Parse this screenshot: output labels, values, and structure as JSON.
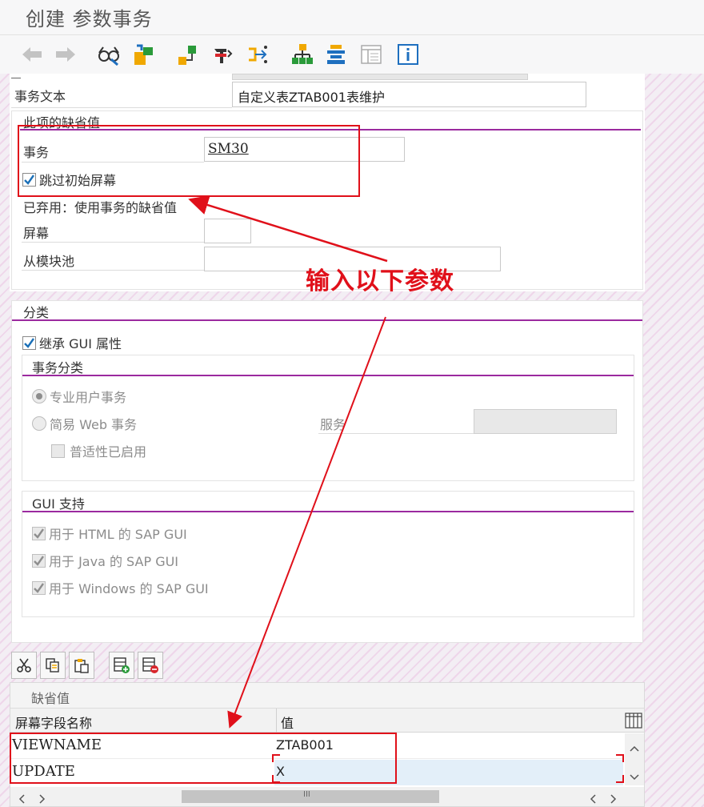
{
  "window": {
    "title": "创建 参数事务"
  },
  "toolbar": {
    "icons": [
      "back-arrow-icon",
      "forward-arrow-icon",
      "glasses-icon",
      "transport-icon",
      "hierarchy-icon",
      "where-used-icon",
      "navigate-icon",
      "tree-icon",
      "stack-icon",
      "layout-icon",
      "info-icon"
    ]
  },
  "transaction": {
    "text_label": "事务文本",
    "text_value": "自定义表ZTAB001表维护"
  },
  "defaults": {
    "title": "此项的缺省值",
    "transaction_label": "事务",
    "transaction_value": "SM30",
    "skip_initial_label": "跳过初始屏幕",
    "deprecated_text": "已弃用：使用事务的缺省值",
    "screen_label": "屏幕",
    "module_pool_label": "从模块池"
  },
  "annotation": {
    "text": "输入以下参数",
    "color": "#e0101a"
  },
  "classification": {
    "title": "分类",
    "inherit_gui_label": "继承 GUI 属性",
    "tx_class_title": "事务分类",
    "pro_user_label": "专业用户事务",
    "easy_web_label": "简易 Web 事务",
    "service_label": "服务",
    "pervasive_label": "普适性已启用",
    "gui_support_title": "GUI 支持",
    "html_gui_label": "用于 HTML 的 SAP GUI",
    "java_gui_label": "用于 Java 的 SAP GUI",
    "windows_gui_label": "用于 Windows 的 SAP GUI"
  },
  "grid": {
    "title": "缺省值",
    "col_name": "屏幕字段名称",
    "col_value": "值",
    "rows": [
      {
        "name": "VIEWNAME",
        "value": "ZTAB001"
      },
      {
        "name": "UPDATE",
        "value": "X"
      }
    ],
    "scroll_mid": "III"
  },
  "colors": {
    "accent_purple": "#9b2a9f",
    "highlight_red": "#e0101a",
    "check_blue": "#1a6fb7"
  }
}
